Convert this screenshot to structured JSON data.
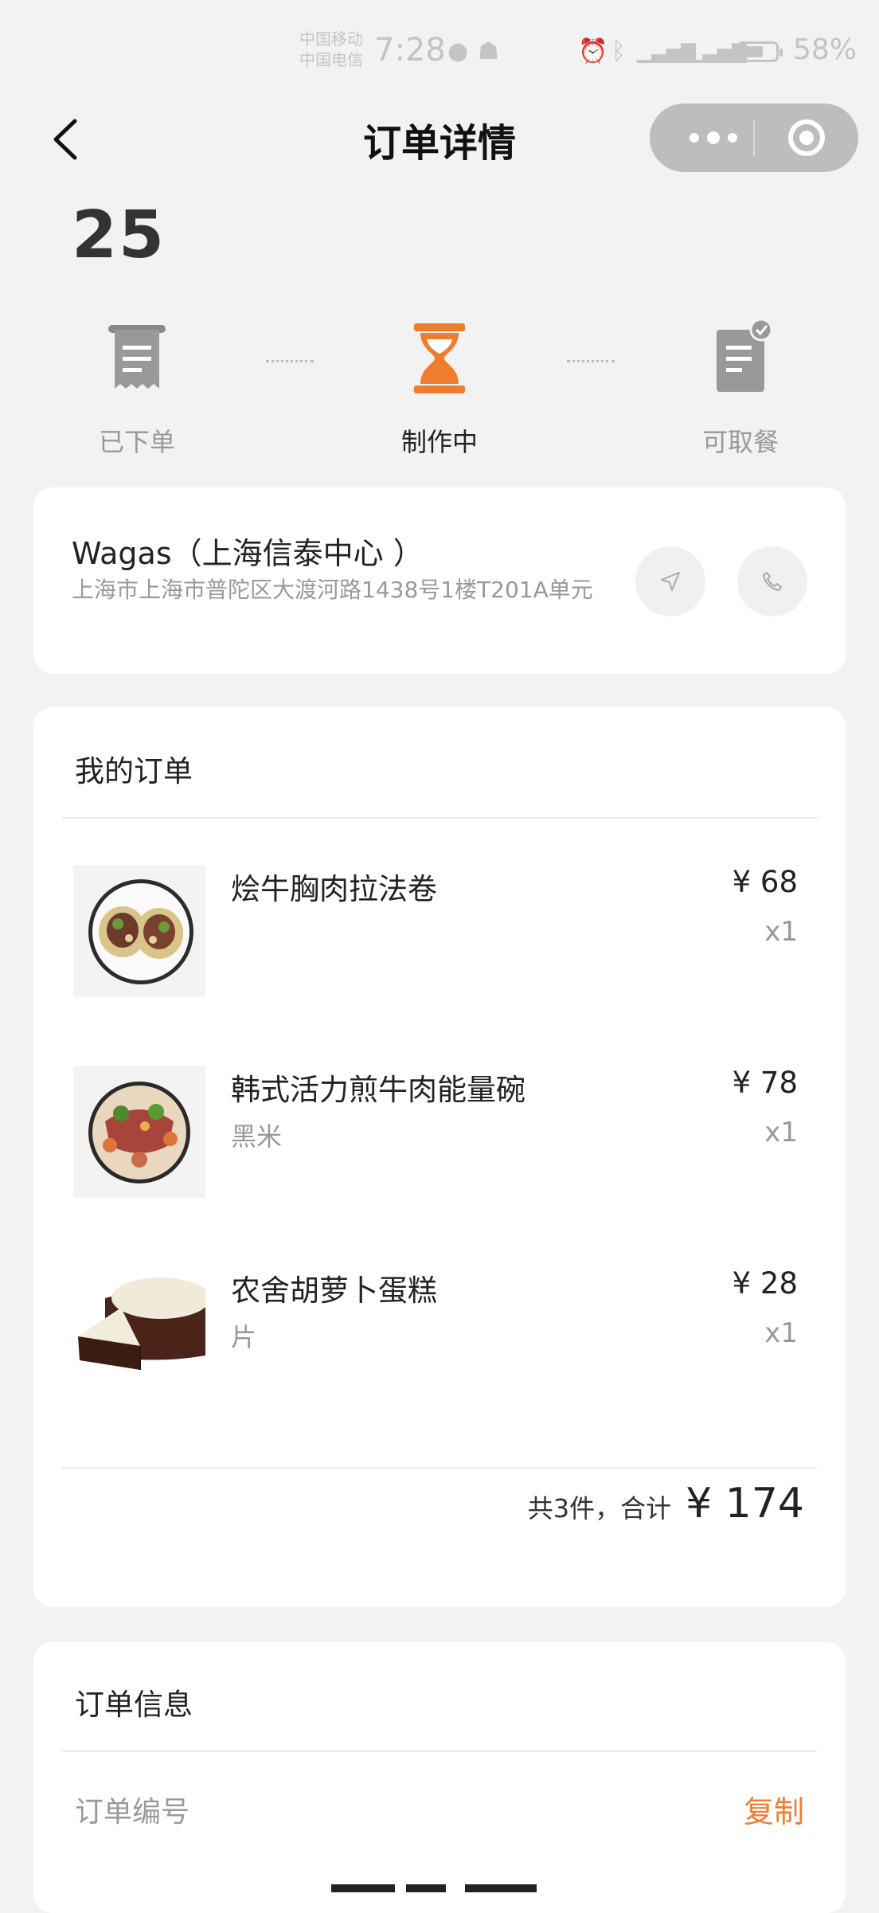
{
  "status_bar": {
    "carrier_1": "中国移动",
    "carrier_2": "中国电信",
    "time": "7:28",
    "battery": "58%",
    "icons": [
      "alarm-icon",
      "bluetooth-icon",
      "signal-5g-icon",
      "signal-4g-icon",
      "battery-icon"
    ]
  },
  "nav": {
    "title": "订单详情",
    "back_icon": "chevron-left-icon",
    "more_icon": "more-dots-icon",
    "close_icon": "target-icon"
  },
  "order_number": "25",
  "progress": {
    "steps": [
      {
        "label": "已下单",
        "icon": "receipt-icon",
        "state": "done"
      },
      {
        "label": "制作中",
        "icon": "hourglass-icon",
        "state": "active"
      },
      {
        "label": "可取餐",
        "icon": "document-check-icon",
        "state": "pending"
      }
    ],
    "active_color": "#f07d2e"
  },
  "store": {
    "name": "Wagas（上海信泰中心 ）",
    "address": "上海市上海市普陀区大渡河路1438号1楼T201A单元",
    "nav_icon": "navigation-arrow-icon",
    "phone_icon": "phone-icon"
  },
  "my_order": {
    "title": "我的订单",
    "items": [
      {
        "name": "烩牛胸肉拉法卷",
        "option": "",
        "price": "¥ 68",
        "qty": "x1",
        "image": "wrap-image"
      },
      {
        "name": "韩式活力煎牛肉能量碗",
        "option": "黑米",
        "price": "¥ 78",
        "qty": "x1",
        "image": "beef-bowl-image"
      },
      {
        "name": "农舍胡萝卜蛋糕",
        "option": "片",
        "price": "¥ 28",
        "qty": "x1",
        "image": "carrot-cake-image"
      }
    ],
    "summary_text": "共3件，合计",
    "total": "¥ 174"
  },
  "order_info": {
    "title": "订单信息",
    "row_label": "订单编号",
    "copy_label": "复制",
    "accent_color": "#f07d2e"
  }
}
